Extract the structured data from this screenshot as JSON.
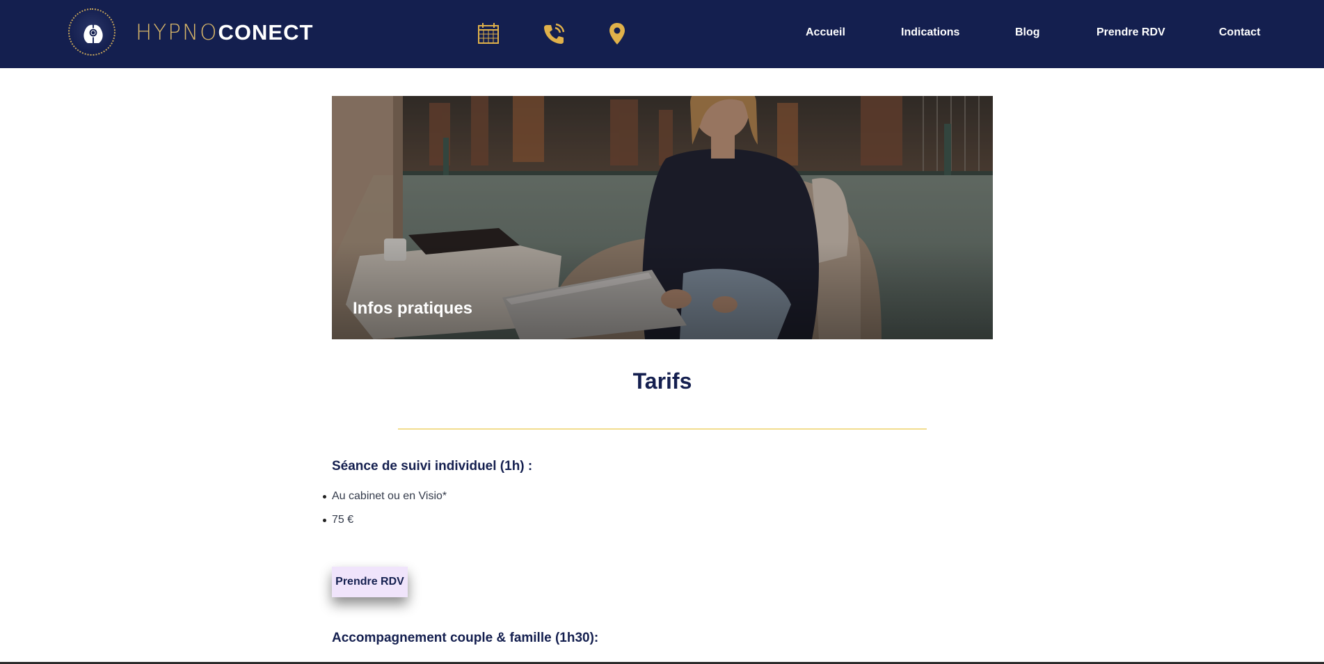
{
  "header": {
    "brand_light": "HYPNO",
    "brand_bold": "CONECT",
    "icons": [
      "calendar-icon",
      "phone-icon",
      "map-pin-icon"
    ],
    "nav": [
      "Accueil",
      "Indications",
      "Blog",
      "Prendre RDV",
      "Contact"
    ]
  },
  "hero": {
    "title": "Infos pratiques"
  },
  "tarifs": {
    "title": "Tarifs",
    "session1": {
      "heading": "Séance de suivi individuel (1h) :",
      "items": [
        "Au cabinet ou en Visio*",
        "75 €"
      ],
      "cta": "Prendre RDV"
    },
    "session2": {
      "heading": "Accompagnement couple & famille (1h30):"
    }
  },
  "colors": {
    "header_bg": "#141f4f",
    "gold": "#e0b14a",
    "title_navy": "#141f4f",
    "button_bg": "#f0e4fb",
    "divider": "#f2dd8e"
  }
}
